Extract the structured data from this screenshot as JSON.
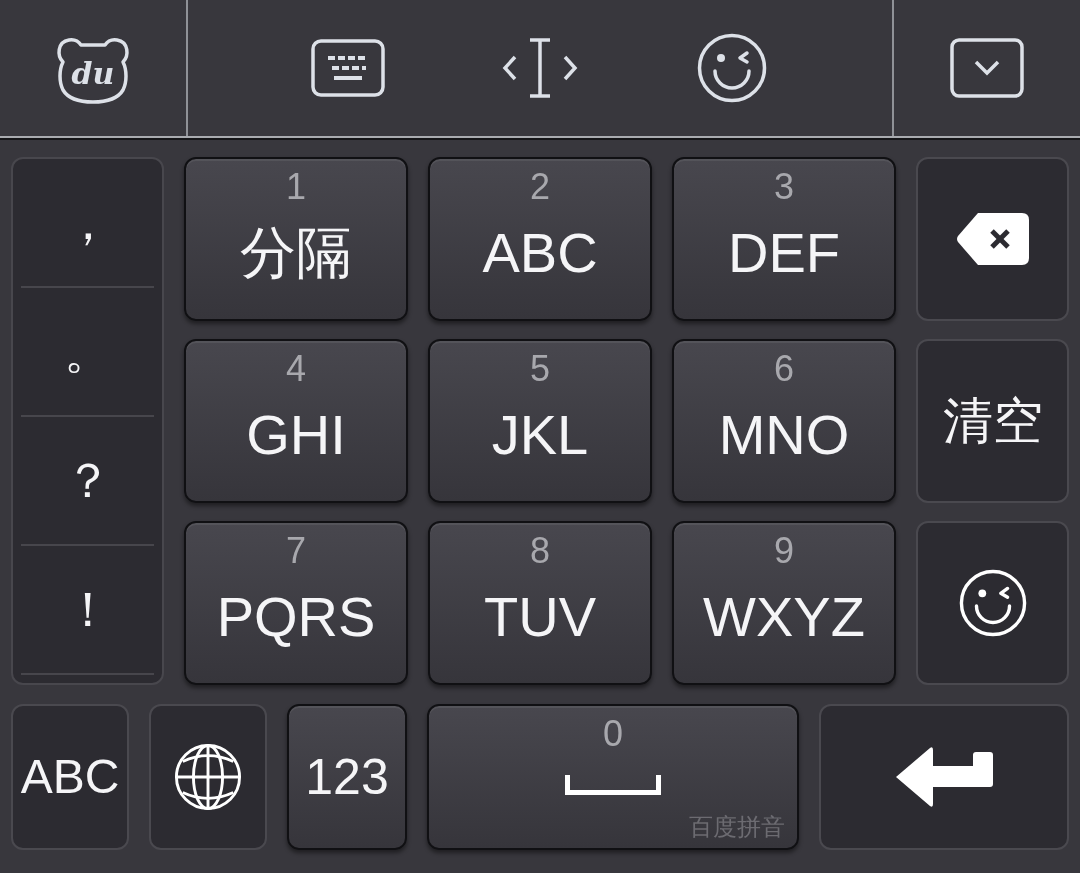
{
  "toolbar": {
    "logo": {
      "text": "du"
    },
    "tools": [
      {
        "kind": "keyboard"
      },
      {
        "kind": "cursor"
      },
      {
        "kind": "emoji"
      }
    ],
    "end_tools": [
      {
        "kind": "collapse"
      }
    ]
  },
  "punctuation": [
    "，",
    "。",
    "？",
    "！"
  ],
  "keypad": [
    {
      "digit": "1",
      "label": "分隔"
    },
    {
      "digit": "2",
      "label": "ABC"
    },
    {
      "digit": "3",
      "label": "DEF"
    },
    {
      "digit": "4",
      "label": "GHI"
    },
    {
      "digit": "5",
      "label": "JKL"
    },
    {
      "digit": "6",
      "label": "MNO"
    },
    {
      "digit": "7",
      "label": "PQRS"
    },
    {
      "digit": "8",
      "label": "TUV"
    },
    {
      "digit": "9",
      "label": "WXYZ"
    }
  ],
  "side_keys": [
    {
      "kind": "backspace"
    },
    {
      "kind": "clear",
      "label": "清空"
    },
    {
      "kind": "emoji"
    }
  ],
  "bottom_row": [
    {
      "kind": "alphabet",
      "label": "ABC",
      "raised": false
    },
    {
      "kind": "globe",
      "raised": false
    },
    {
      "kind": "numbers",
      "label": "123",
      "raised": true
    },
    {
      "kind": "space",
      "digit": "0",
      "brand": "百度拼音",
      "raised": true
    },
    {
      "kind": "enter",
      "raised": false
    }
  ]
}
